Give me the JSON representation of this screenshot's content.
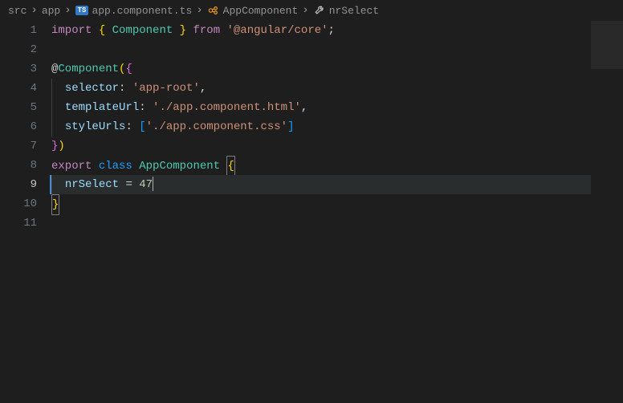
{
  "breadcrumb": {
    "items": [
      {
        "label": "src",
        "kind": "folder"
      },
      {
        "label": "app",
        "kind": "folder"
      },
      {
        "label": "app.component.ts",
        "kind": "ts-file",
        "badge": "TS"
      },
      {
        "label": "AppComponent",
        "kind": "class"
      },
      {
        "label": "nrSelect",
        "kind": "property"
      }
    ],
    "separator": "›"
  },
  "editor": {
    "line_numbers": [
      "1",
      "2",
      "3",
      "4",
      "5",
      "6",
      "7",
      "8",
      "9",
      "10",
      "11"
    ],
    "current_line_index": 8,
    "code": {
      "l1": {
        "import": "import",
        "lb": "{",
        "component": "Component",
        "rb": "}",
        "from": "from",
        "module": "'@angular/core'",
        "semi": ";"
      },
      "l3": {
        "at": "@",
        "decorator": "Component",
        "open": "(",
        "brace": "{"
      },
      "l4": {
        "key": "selector",
        "colon": ":",
        "val": "'app-root'",
        "comma": ","
      },
      "l5": {
        "key": "templateUrl",
        "colon": ":",
        "val": "'./app.component.html'",
        "comma": ","
      },
      "l6": {
        "key": "styleUrls",
        "colon": ":",
        "lb": "[",
        "val": "'./app.component.css'",
        "rb": "]"
      },
      "l7": {
        "rb": "}",
        "rp": ")"
      },
      "l8": {
        "export": "export",
        "class": "class",
        "name": "AppComponent",
        "brace": "{"
      },
      "l9": {
        "prop": "nrSelect",
        "eq": "=",
        "val": "47"
      },
      "l10": {
        "brace": "}"
      }
    }
  },
  "icons": {
    "class": "class-icon",
    "property": "wrench-icon"
  }
}
